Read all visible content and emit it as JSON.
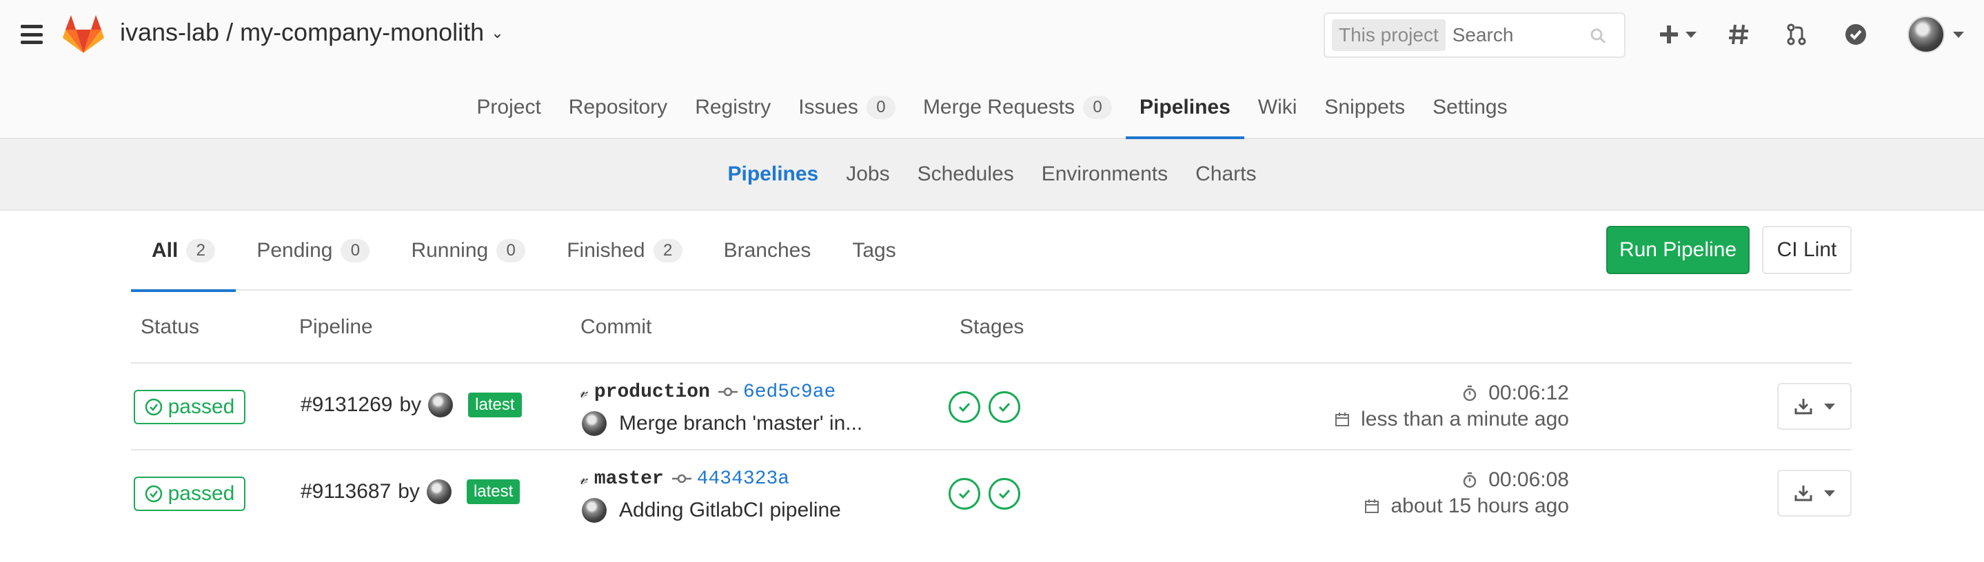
{
  "header": {
    "project_path": "ivans-lab / my-company-monolith",
    "search": {
      "scope": "This project",
      "placeholder": "Search"
    }
  },
  "nav": {
    "items": [
      {
        "label": "Project"
      },
      {
        "label": "Repository"
      },
      {
        "label": "Registry"
      },
      {
        "label": "Issues",
        "count": "0"
      },
      {
        "label": "Merge Requests",
        "count": "0"
      },
      {
        "label": "Pipelines",
        "active": true
      },
      {
        "label": "Wiki"
      },
      {
        "label": "Snippets"
      },
      {
        "label": "Settings"
      }
    ]
  },
  "subnav": {
    "items": [
      {
        "label": "Pipelines",
        "active": true
      },
      {
        "label": "Jobs"
      },
      {
        "label": "Schedules"
      },
      {
        "label": "Environments"
      },
      {
        "label": "Charts"
      }
    ]
  },
  "tabs": [
    {
      "label": "All",
      "count": "2",
      "active": true
    },
    {
      "label": "Pending",
      "count": "0"
    },
    {
      "label": "Running",
      "count": "0"
    },
    {
      "label": "Finished",
      "count": "2"
    },
    {
      "label": "Branches"
    },
    {
      "label": "Tags"
    }
  ],
  "actions": {
    "run_pipeline": "Run Pipeline",
    "ci_lint": "CI Lint"
  },
  "table": {
    "headers": {
      "status": "Status",
      "pipeline": "Pipeline",
      "commit": "Commit",
      "stages": "Stages"
    },
    "rows": [
      {
        "status": "passed",
        "pipeline_id": "#9131269",
        "by": "by",
        "latest": "latest",
        "ref": "production",
        "sha": "6ed5c9ae",
        "commit_title": "Merge branch 'master' in...",
        "duration": "00:06:12",
        "finished": "less than a minute ago",
        "stages": [
          "passed",
          "passed"
        ]
      },
      {
        "status": "passed",
        "pipeline_id": "#9113687",
        "by": "by",
        "latest": "latest",
        "ref": "master",
        "sha": "4434323a",
        "commit_title": "Adding GitlabCI pipeline",
        "duration": "00:06:08",
        "finished": "about 15 hours ago",
        "stages": [
          "passed",
          "passed"
        ]
      }
    ]
  },
  "colors": {
    "accent": "#1f78d1",
    "success": "#1aaa55",
    "logo": "#e24329"
  },
  "icons": [
    "hamburger-icon",
    "gitlab-logo",
    "chevron-down-icon",
    "search-icon",
    "plus-icon",
    "hash-icon",
    "merge-request-icon",
    "todo-check-icon",
    "user-avatar",
    "branch-icon",
    "commit-icon",
    "check-icon",
    "timer-icon",
    "calendar-icon",
    "download-icon"
  ]
}
